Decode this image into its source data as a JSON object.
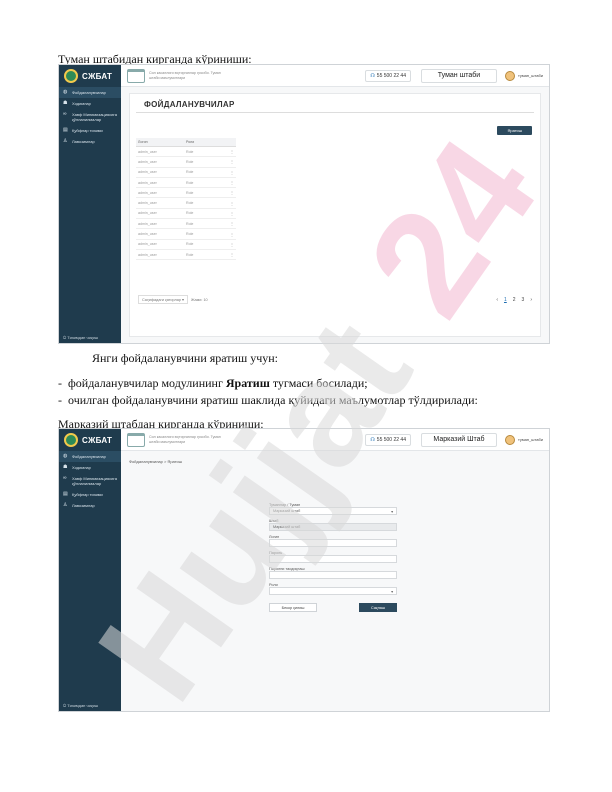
{
  "caption1": "Туман штабидан кирганда кўриниши:",
  "para_intro": "Янги фойдаланувчини яратиш учун:",
  "bullet1_pre": "фойдаланувчилар модулининг ",
  "bullet1_bold": "Яратиш",
  "bullet1_post": " тугмаси босилади;",
  "bullet2": "очилган фойдаланувчини яратиш шаклида қуйидаги маълумотлар тўлдирилади:",
  "caption2": "Марказий штабдан кирганда кўриниши:",
  "dash": "-",
  "sidebar": {
    "brand": "СЖБАТ",
    "items": [
      {
        "label": "Фойдаланувчилар",
        "icon": "globe-icon"
      },
      {
        "label": "Ходимлар",
        "icon": "users-icon"
      },
      {
        "label": "Хавф Минимизациясига қўлланилмалар",
        "icon": "link-icon"
      },
      {
        "label": "Қуйфлар тизими",
        "icon": "calendar-icon"
      },
      {
        "label": "Лавозимлар",
        "icon": "user-icon"
      }
    ],
    "footer": "Тизимдан чиқиш"
  },
  "topbar": {
    "title": "Сил касаллиги юқтирганлар ҳисоби. Туман штаби маълумотлари",
    "phone": "55 500 22 44",
    "user": "туман_штаби"
  },
  "screen1": {
    "hq": "Туман штаби",
    "page_title": "ФОЙДАЛАНУВЧИЛАР",
    "create_button": "Яратиш",
    "col_user": "Логин",
    "col_role": "Роли",
    "rows": [
      {
        "login": "admin_user",
        "role": "Role"
      },
      {
        "login": "admin_user",
        "role": "Role"
      },
      {
        "login": "admin_user",
        "role": "Role"
      },
      {
        "login": "admin_user",
        "role": "Role"
      },
      {
        "login": "admin_user",
        "role": "Role"
      },
      {
        "login": "admin_user",
        "role": "Role"
      },
      {
        "login": "admin_user",
        "role": "Role"
      },
      {
        "login": "admin_user",
        "role": "Role"
      },
      {
        "login": "admin_user",
        "role": "Role"
      },
      {
        "login": "admin_user",
        "role": "Role"
      },
      {
        "login": "admin_user",
        "role": "Role"
      }
    ],
    "row_action": "⋮",
    "per_page": "Саҳифадаги қаторлар",
    "total": "Жами: 10",
    "pages": [
      "1",
      "2",
      "3"
    ]
  },
  "screen2": {
    "hq": "Марказий Штаб",
    "breadcrumb": "Фойдаланувчилар > Яратиш",
    "f_district_label": "Туманлар / Туман",
    "f_district_value": "Марказий штаб",
    "f_hq_label": "Штаб",
    "f_hq_value": "Марказий штаб",
    "f_login_label": "Логин",
    "f_pass_label": "Пароль",
    "f_pass2_label": "Паролни тасдиқлаш",
    "f_role_label": "Роли",
    "cancel": "Бекор қилиш",
    "save": "Сақлаш"
  },
  "watermark": "Hujjat24",
  "colors": {
    "sidebar": "#1f3b4d",
    "accent": "#2c4a5e",
    "watermark_pink": "#f3b7d0",
    "watermark_gray": "#d9d9d9"
  }
}
